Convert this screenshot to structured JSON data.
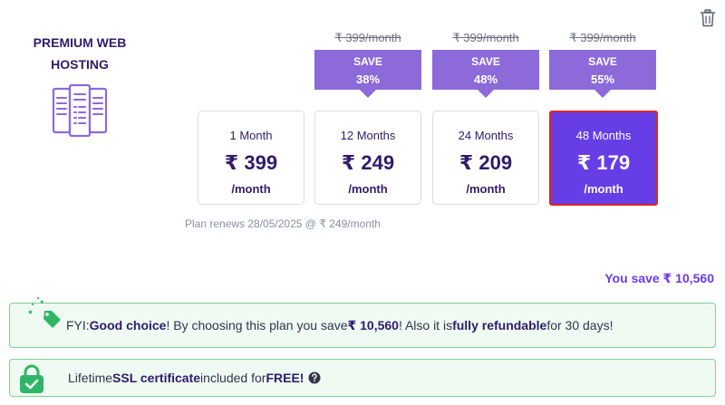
{
  "product": {
    "title": "PREMIUM WEB HOSTING"
  },
  "plans": [
    {
      "label": "1 Month",
      "price": "₹ 399",
      "per": "/month"
    },
    {
      "label": "12 Months",
      "price": "₹ 249",
      "per": "/month",
      "old_price": "₹ 399/month",
      "save_label": "SAVE",
      "save_pct": "38%"
    },
    {
      "label": "24 Months",
      "price": "₹ 209",
      "per": "/month",
      "old_price": "₹ 399/month",
      "save_label": "SAVE",
      "save_pct": "48%"
    },
    {
      "label": "48 Months",
      "price": "₹ 179",
      "per": "/month",
      "old_price": "₹ 399/month",
      "save_label": "SAVE",
      "save_pct": "55%",
      "selected": true
    }
  ],
  "renewal_text": "Plan renews 28/05/2025 @ ₹ 249/month",
  "savings_text": "You save ₹ 10,560",
  "fyi": {
    "prefix": "FYI: ",
    "good_choice": "Good choice",
    "mid": "! By choosing this plan you save ",
    "amount": "₹ 10,560",
    "mid2": "! Also it is ",
    "refundable": "fully refundable",
    "suffix": " for 30 days!"
  },
  "ssl": {
    "prefix": "Lifetime ",
    "cert": "SSL certificate",
    "mid": " included for ",
    "free": "FREE!"
  },
  "colors": {
    "accent": "#673de6",
    "badge": "#8c6ad9",
    "selected_border": "#e02424",
    "notice_bg": "#eefaf2",
    "notice_border": "#7fd096"
  },
  "icons": [
    "trash-icon",
    "server-icon",
    "tag-icon",
    "lock-icon",
    "help-icon"
  ]
}
